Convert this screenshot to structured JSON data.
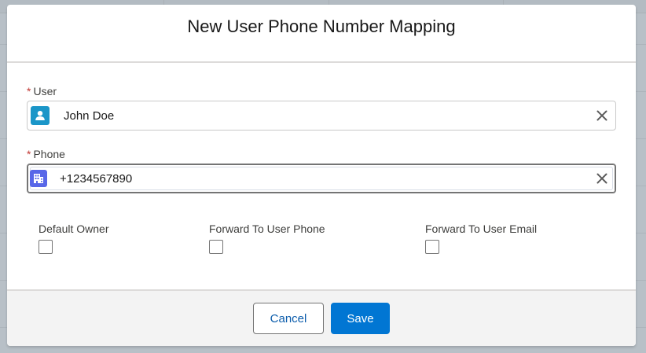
{
  "modal": {
    "title": "New User Phone Number Mapping"
  },
  "fields": {
    "required_marker": "*",
    "user": {
      "label": "User",
      "value": "John Doe",
      "icon": "user-icon"
    },
    "phone": {
      "label": "Phone",
      "value": "+1234567890",
      "icon": "building-icon"
    }
  },
  "checkboxes": [
    {
      "label": "Default Owner",
      "checked": false
    },
    {
      "label": "Forward To User Phone",
      "checked": false
    },
    {
      "label": "Forward To User Email",
      "checked": false
    }
  ],
  "footer": {
    "cancel_label": "Cancel",
    "save_label": "Save"
  },
  "colors": {
    "brand": "#0176d3",
    "user_icon_bg": "#1b96c8",
    "account_icon_bg": "#5867e8",
    "required": "#c23934"
  }
}
